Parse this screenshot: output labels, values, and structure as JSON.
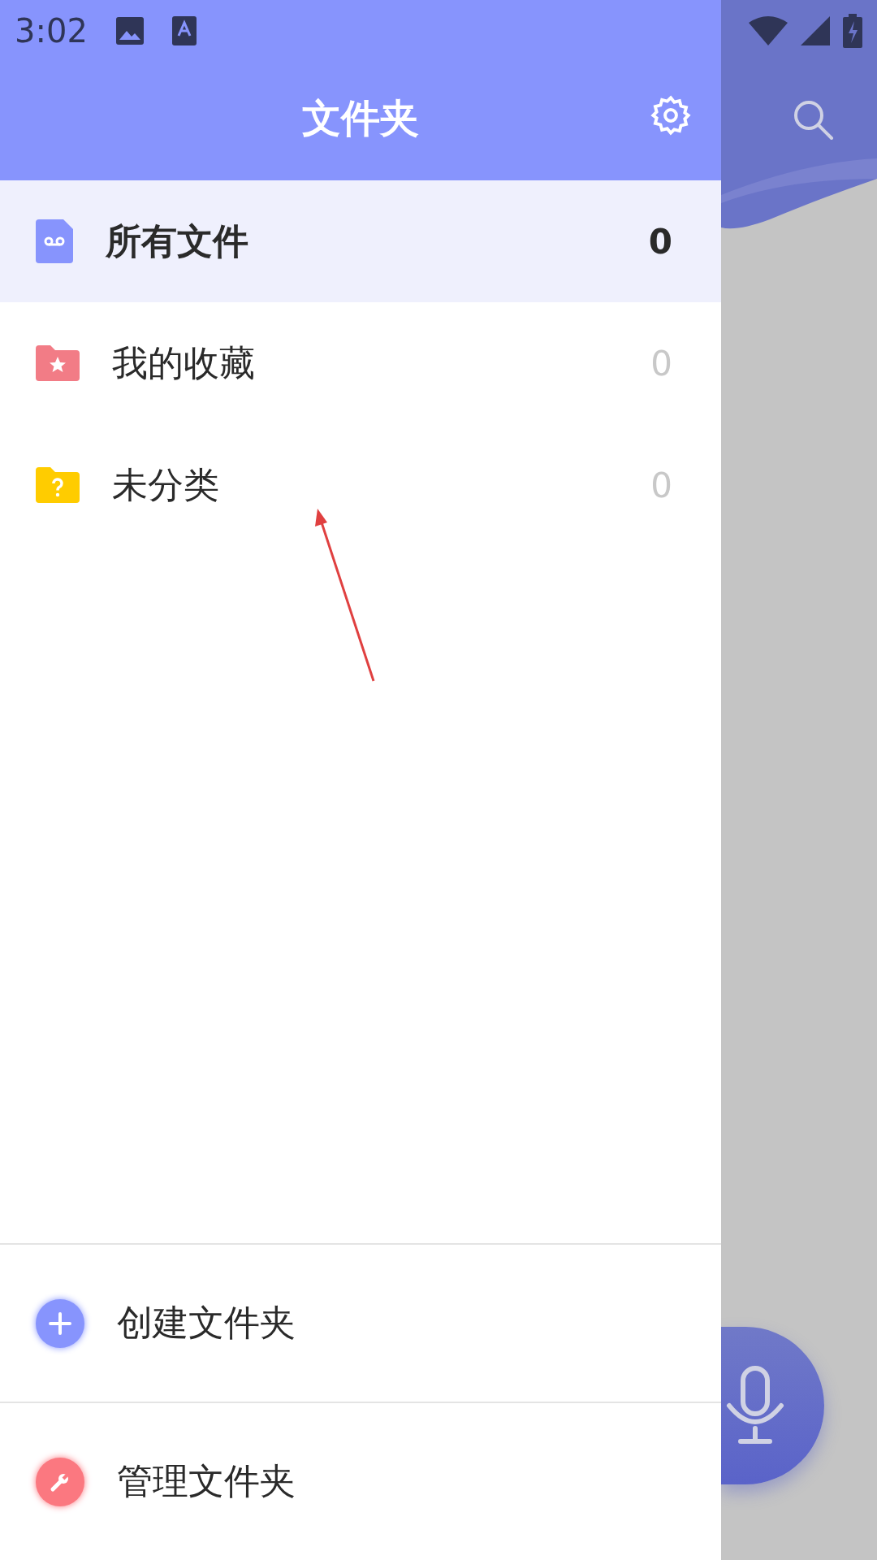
{
  "status_bar": {
    "time": "3:02"
  },
  "drawer": {
    "title": "文件夹"
  },
  "folders": [
    {
      "kind": "all",
      "name": "所有文件",
      "count": "0",
      "selected": true
    },
    {
      "kind": "favorites",
      "name": "我的收藏",
      "count": "0",
      "selected": false
    },
    {
      "kind": "uncategorized",
      "name": "未分类",
      "count": "0",
      "selected": false
    }
  ],
  "actions": [
    {
      "kind": "create",
      "label": "创建文件夹"
    },
    {
      "kind": "manage",
      "label": "管理文件夹"
    }
  ]
}
